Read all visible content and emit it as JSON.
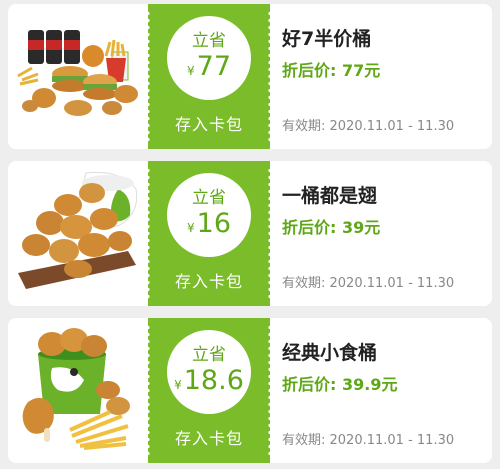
{
  "colors": {
    "accent": "#7bbc2a",
    "accent_text": "#5ea716",
    "card": "#ffffff",
    "background": "#eeeeee"
  },
  "coupons": [
    {
      "image": "family-meal-icon",
      "save_label": "立省",
      "currency": "¥",
      "amount": "77",
      "store_label": "存入卡包",
      "name": "好7半价桶",
      "price": "折后价: 77元",
      "validity": "有效期: 2020.11.01 - 11.30"
    },
    {
      "image": "wings-bucket-icon",
      "save_label": "立省",
      "currency": "¥",
      "amount": "16",
      "store_label": "存入卡包",
      "name": "一桶都是翅",
      "price": "折后价: 39元",
      "validity": "有效期: 2020.11.01 - 11.30"
    },
    {
      "image": "snack-bucket-icon",
      "save_label": "立省",
      "currency": "¥",
      "amount": "18.6",
      "store_label": "存入卡包",
      "name": "经典小食桶",
      "price": "折后价: 39.9元",
      "validity": "有效期: 2020.11.01 - 11.30"
    }
  ]
}
